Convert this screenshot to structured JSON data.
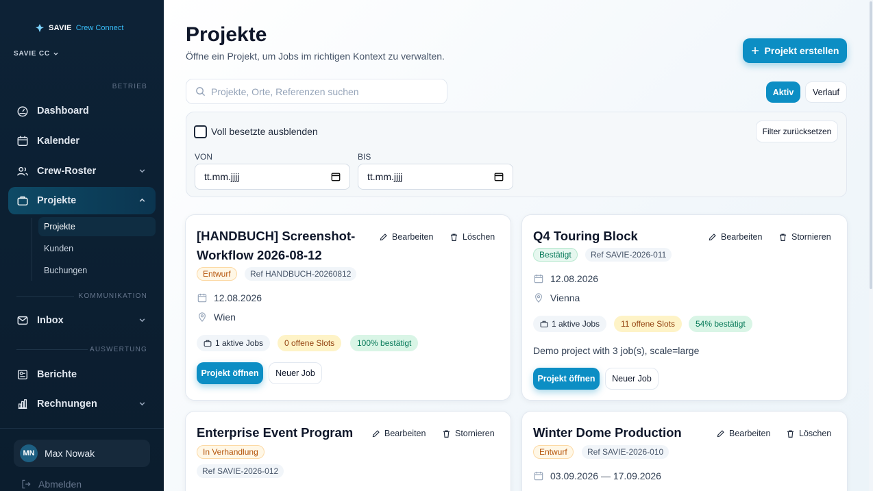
{
  "brand": {
    "name": "SAVIE",
    "product": "Crew Connect"
  },
  "org_switcher": {
    "label": "SAVIE CC"
  },
  "sidebar": {
    "section_betrieb": "BETRIEB",
    "section_kommunikation": "KOMMUNIKATION",
    "section_auswertung": "AUSWERTUNG",
    "items": [
      {
        "label": "Dashboard",
        "icon": "gauge-icon"
      },
      {
        "label": "Kalender",
        "icon": "calendar-icon"
      },
      {
        "label": "Crew-Roster",
        "icon": "users-icon"
      },
      {
        "label": "Projekte",
        "icon": "briefcase-icon"
      },
      {
        "label": "Inbox",
        "icon": "inbox-icon"
      },
      {
        "label": "Berichte",
        "icon": "report-icon"
      },
      {
        "label": "Rechnungen",
        "icon": "bar-chart-icon"
      }
    ],
    "projekte_sub": [
      "Projekte",
      "Kunden",
      "Buchungen"
    ]
  },
  "user": {
    "initials": "MN",
    "name": "Max Nowak",
    "logout": "Abmelden"
  },
  "page": {
    "title": "Projekte",
    "subtitle": "Öffne ein Projekt, um Jobs im richtigen Kontext zu verwalten.",
    "create_button": "Projekt erstellen",
    "search_placeholder": "Projekte, Orte, Referenzen suchen",
    "toggle_active": "Aktiv",
    "toggle_history": "Verlauf"
  },
  "filters": {
    "hide_full_label": "Voll besetzte ausblenden",
    "reset_label": "Filter zurücksetzen",
    "from_label": "VON",
    "to_label": "BIS",
    "from_value": "tt.mm.jjjj",
    "to_value": "tt.mm.jjjj"
  },
  "cards": [
    {
      "title_line1": "[HANDBUCH] Screenshot-",
      "title_line2": "Workflow 2026-08-12",
      "edit_label": "Bearbeiten",
      "delete_label": "Löschen",
      "status": "Entwurf",
      "ref": "Ref HANDBUCH-20260812",
      "date": "12.08.2026",
      "location": "Wien",
      "jobs_chip": "1 aktive Jobs",
      "slots_chip": "0 offene Slots",
      "confirmed_chip": "100% bestätigt",
      "open_button": "Projekt öffnen",
      "new_job_button": "Neuer Job"
    },
    {
      "title": "Q4 Touring Block",
      "edit_label": "Bearbeiten",
      "delete_label": "Stornieren",
      "status": "Bestätigt",
      "ref": "Ref SAVIE-2026-011",
      "date": "12.08.2026",
      "location": "Vienna",
      "jobs_chip": "1 aktive Jobs",
      "slots_chip": "11 offene Slots",
      "confirmed_chip": "54% bestätigt",
      "description": "Demo project with 3 job(s), scale=large",
      "open_button": "Projekt öffnen",
      "new_job_button": "Neuer Job"
    },
    {
      "title": "Enterprise Event Program",
      "edit_label": "Bearbeiten",
      "delete_label": "Stornieren",
      "status": "In Verhandlung",
      "ref": "Ref SAVIE-2026-012"
    },
    {
      "title": "Winter Dome Production",
      "edit_label": "Bearbeiten",
      "delete_label": "Löschen",
      "status": "Entwurf",
      "ref": "Ref SAVIE-2026-010",
      "date": "03.09.2026 — 17.09.2026"
    }
  ]
}
